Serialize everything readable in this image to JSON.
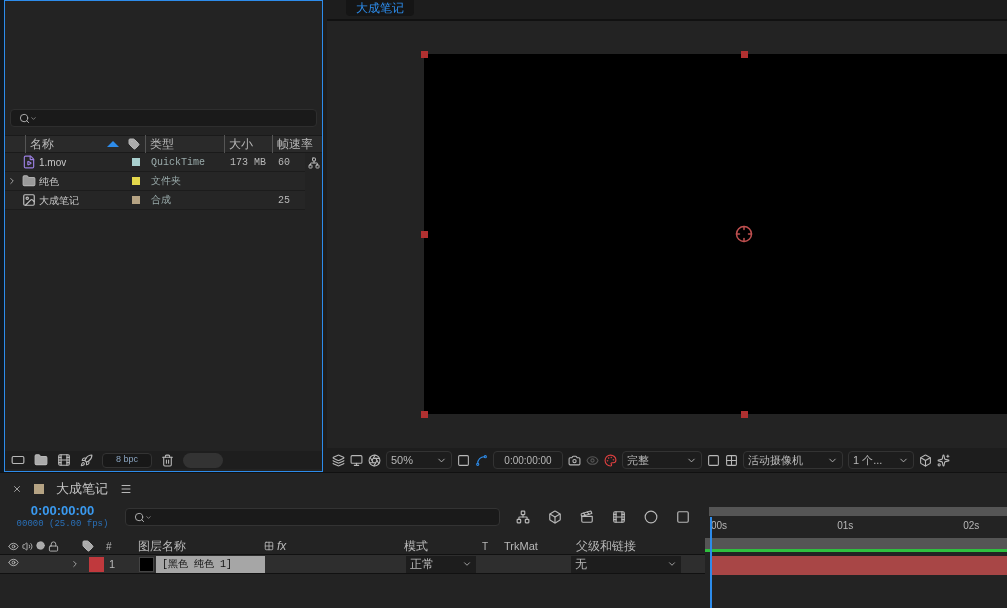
{
  "project": {
    "columns": [
      {
        "label": "名称",
        "sorted": true
      },
      {
        "label": "类型",
        "sorted": false
      },
      {
        "label": "大小",
        "sorted": false
      },
      {
        "label": "帧速率",
        "sorted": false
      }
    ],
    "items": [
      {
        "kind": "footage",
        "name": "1.mov",
        "color": "#a9d0cf",
        "type": "QuickTime",
        "size": "173 MB",
        "fps": "60"
      },
      {
        "kind": "folder",
        "name": "纯色",
        "color": "#e4d84c",
        "type": "文件夹"
      },
      {
        "kind": "comp",
        "name": "大成笔记",
        "color": "#b5a383",
        "type": "合成",
        "fps": "25"
      }
    ],
    "bit_depth": "8 bpc"
  },
  "viewer": {
    "tabs": [
      {
        "label": "大成笔记",
        "selected": true
      }
    ],
    "toolbar": {
      "zoom": "50%",
      "time": "0:00:00:00",
      "resolution": "完整",
      "camera": "活动摄像机",
      "views": "1 个..."
    }
  },
  "timeline": {
    "tab": {
      "title": "大成笔记",
      "color": "#b5a383"
    },
    "current_time": "0:00:00:00",
    "frame_info": "00000 (25.00 fps)",
    "columns": {
      "number": "#",
      "layer_name": "图层名称",
      "fx": "fx",
      "mode": "模式",
      "t": "T",
      "trkmat": "TrkMat",
      "parent": "父级和链接"
    },
    "layers": [
      {
        "number": "1",
        "name": "[黑色 纯色 1]",
        "color": "#c0393d",
        "visible": true,
        "selected": true,
        "mode": "正常",
        "parent": "无"
      }
    ],
    "ruler": [
      "00s",
      "01s",
      "02s"
    ]
  }
}
